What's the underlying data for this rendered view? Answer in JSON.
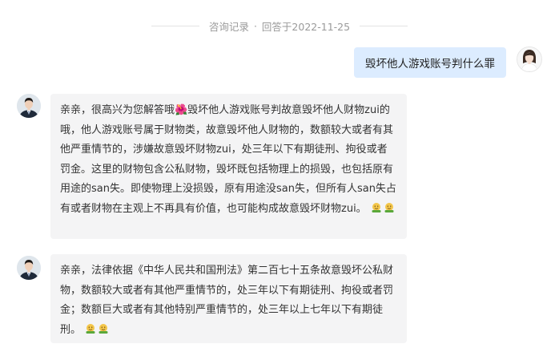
{
  "header": {
    "label": "咨询记录",
    "separator": "·",
    "answered": "回答于2022-11-25"
  },
  "user_message": {
    "text": "毁坏他人游戏账号判什么罪"
  },
  "answers": [
    {
      "text": "亲亲，很高兴为您解答哦🌺毁坏他人游戏账号判故意毁坏他人财物zui的哦，他人游戏账号属于财物类，故意毁坏他人财物的，数额较大或者有其他严重情节的，涉嫌故意毁坏财物zui，处三年以下有期徒刑、拘役或者罚金。这里的财物包含公私财物，毁坏既包括物理上的损毁，也包括原有用途的san失。即使物理上没损毁，原有用途没san失，但所有人san失占有或者财物在主观上不再具有价值，也可能构成故意毁坏财物zui。",
      "emoji": "🤗🤗"
    },
    {
      "text": "亲亲，法律依据《中华人民共和国刑法》第二百七十五条故意毁坏公私财物，数额较大或者有其他严重情节的，处三年以下有期徒刑、拘役或者罚金；数额巨大或者有其他特别严重情节的，处三年以上七年以下有期徒刑。",
      "emoji": "🤗🤗"
    }
  ],
  "icons": {
    "user_avatar": "user-avatar-icon",
    "lawyer_avatar": "lawyer-avatar-icon",
    "emoji": "hug-emoji-icon"
  },
  "colors": {
    "user_bubble": "#dcecff",
    "answer_bubble": "#f4f4f5",
    "header_text": "#9a9a9a"
  }
}
